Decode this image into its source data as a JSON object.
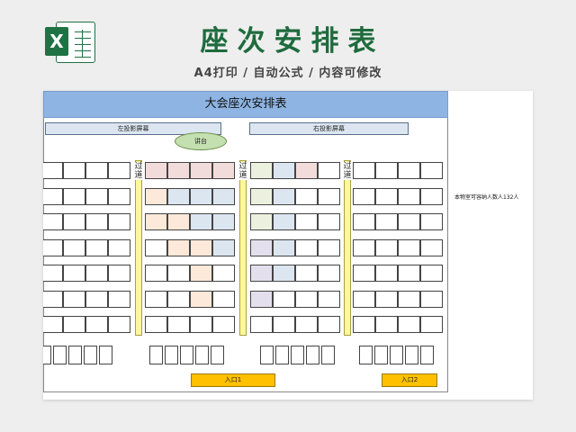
{
  "header": {
    "logo_letter": "X",
    "title": "座次安排表",
    "subtitle": "A4打印 / 自动公式 / 内容可修改"
  },
  "sheet": {
    "banner": "大会座次安排表",
    "left_screen": "左投影屏幕",
    "right_screen": "右投影屏幕",
    "podium": "讲台",
    "aisle_label": "过道",
    "entrance_1": "入口1",
    "entrance_2": "入口2",
    "capacity_note": "本物室可容纳人数人132人"
  },
  "colors": {
    "header_green": "#1f6b3d",
    "banner_blue": "#8db4e2",
    "aisle_yellow": "#fff89a",
    "entrance_orange": "#ffc000",
    "seat_pink": "#f2dcdb",
    "seat_blue": "#dce6f1",
    "seat_peach": "#fde9d9",
    "seat_green": "#ebf1de",
    "seat_purple": "#e4dfec"
  },
  "seat_grid": {
    "rows": 7,
    "blocks": [
      {
        "name": "left",
        "seats_per_row": 4,
        "colors": []
      },
      {
        "name": "center-left",
        "seats_per_row": 4,
        "colors": [
          [
            "pink",
            "pink",
            "pink",
            "pink"
          ],
          [
            "peach",
            "blue",
            "blue",
            "blue"
          ],
          [
            "peach",
            "peach",
            "blue",
            "blue"
          ],
          [
            "",
            "peach",
            "peach",
            "blue"
          ],
          [
            "",
            "",
            "peach",
            ""
          ],
          [
            "",
            "",
            "peach",
            ""
          ],
          [
            "",
            "",
            "",
            ""
          ]
        ]
      },
      {
        "name": "center-right",
        "seats_per_row": 4,
        "colors": [
          [
            "green",
            "blue",
            "pink",
            ""
          ],
          [
            "green",
            "blue",
            "",
            ""
          ],
          [
            "green",
            "blue",
            "",
            ""
          ],
          [
            "purple",
            "blue",
            "",
            ""
          ],
          [
            "purple",
            "blue",
            "",
            ""
          ],
          [
            "purple",
            "",
            "",
            ""
          ],
          [
            "",
            "",
            "",
            ""
          ]
        ]
      },
      {
        "name": "right",
        "seats_per_row": 4,
        "colors": []
      }
    ],
    "back_row_groups": [
      5,
      5,
      5,
      5
    ]
  }
}
